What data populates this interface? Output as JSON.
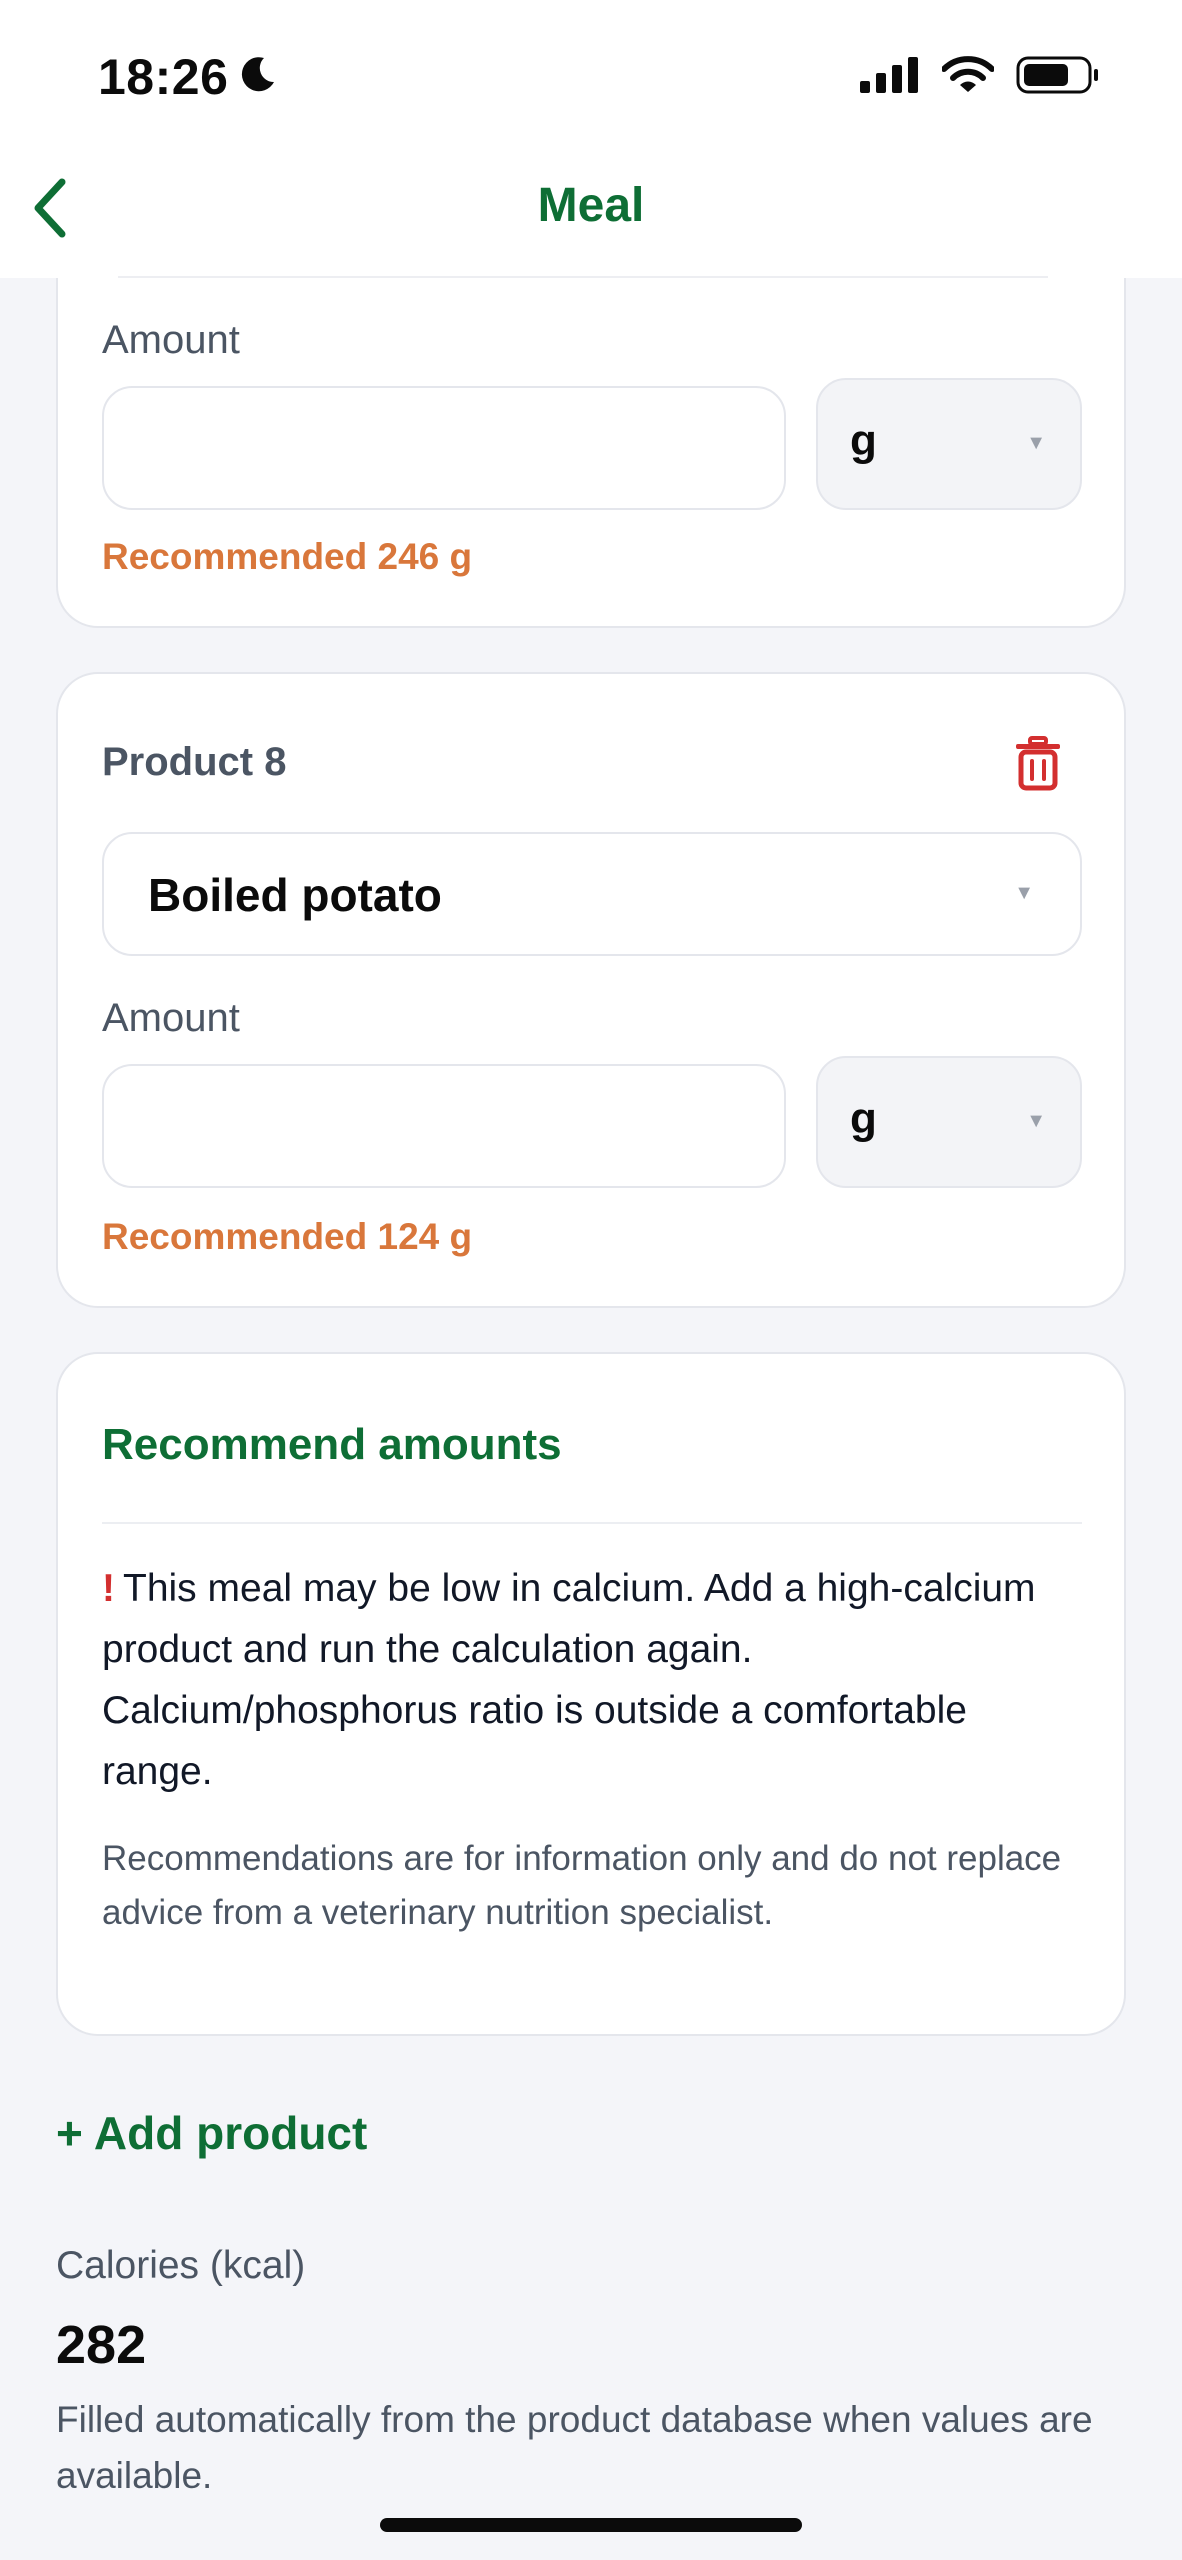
{
  "status_bar": {
    "time": "18:26",
    "icons": [
      "moon-icon",
      "cellular-signal-icon",
      "wifi-icon",
      "battery-icon"
    ]
  },
  "nav": {
    "title": "Meal",
    "back_icon": "chevron-left-icon"
  },
  "product_prev": {
    "amount_label": "Amount",
    "amount_value": "",
    "unit": "g",
    "recommended": "Recommended 246 g"
  },
  "product_8": {
    "title": "Product 8",
    "delete_icon": "trash-icon",
    "product_name": "Boiled potato",
    "amount_label": "Amount",
    "amount_value": "",
    "unit": "g",
    "recommended": "Recommended 124 g"
  },
  "recommend": {
    "title": "Recommend amounts",
    "warning_mark": "!",
    "warning_text": "This meal may be low in calcium. Add a high-calcium product and run the calculation again. Calcium/phosphorus ratio is outside a comfortable range.",
    "disclaimer": "Recommendations are for information only and do not replace advice from a veterinary nutrition specialist."
  },
  "actions": {
    "add_product": "+ Add product"
  },
  "calories": {
    "label": "Calories (kcal)",
    "value": "282",
    "help": "Filled automatically from the product database when values are available."
  },
  "colors": {
    "accent_green": "#0e6e35",
    "recommend_orange": "#d9773b",
    "danger_red": "#d32f2f",
    "background": "#f4f5f9"
  }
}
